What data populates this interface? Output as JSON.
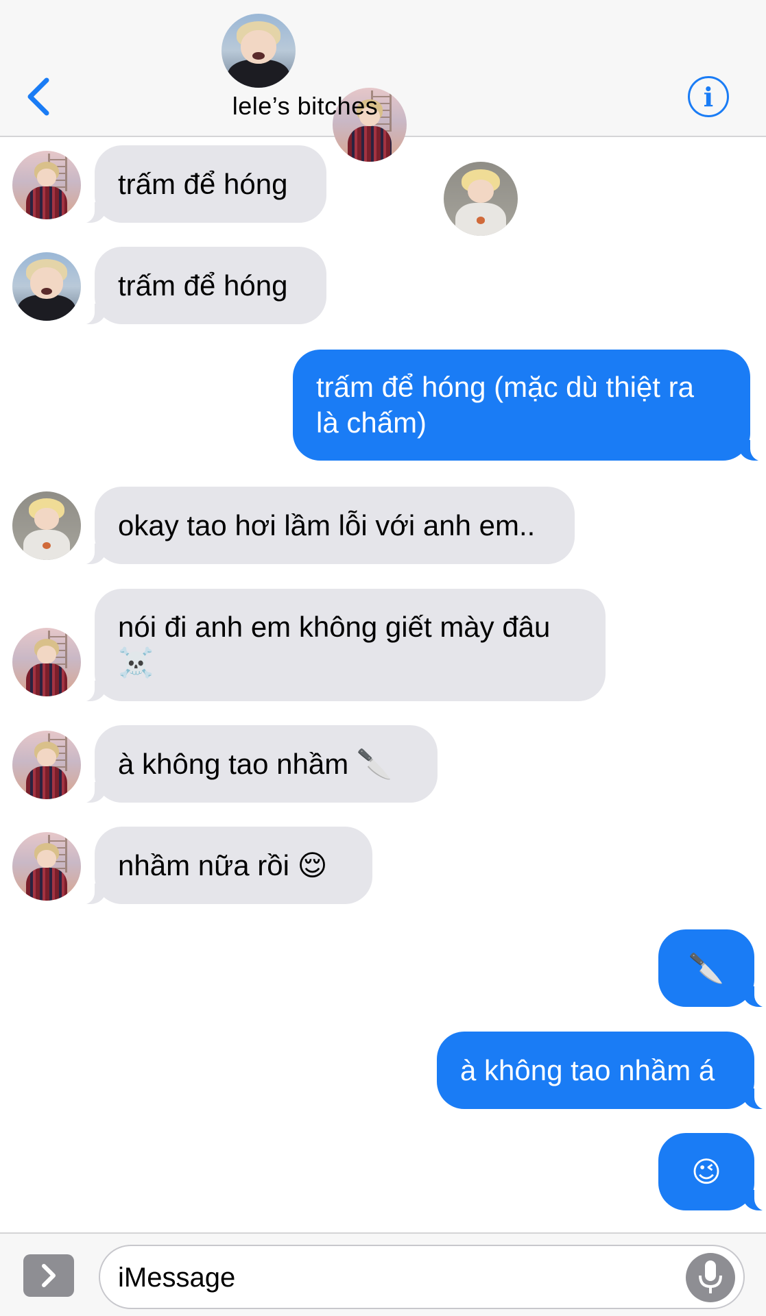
{
  "header": {
    "title": "lele’s bitches",
    "info_label": "i",
    "accent_color": "#1a7cf5"
  },
  "messages": [
    {
      "direction": "incoming",
      "sender_avatar": "avatar-plaid-shirt",
      "text": "trấm để hóng"
    },
    {
      "direction": "incoming",
      "sender_avatar": "avatar-black-hoodie",
      "text": "trấm để hóng"
    },
    {
      "direction": "outgoing",
      "lines": [
        "trấm để hóng (mặc dù thiệt ra",
        "là chấm)"
      ]
    },
    {
      "direction": "incoming",
      "sender_avatar": "avatar-blonde-white-shirt",
      "text": "okay tao hơi lầm lỗi với anh em.."
    },
    {
      "direction": "incoming",
      "sender_avatar": "avatar-plaid-shirt",
      "lines": [
        "nói đi anh em không giết mày đâu",
        "☠️"
      ]
    },
    {
      "direction": "incoming",
      "sender_avatar": "avatar-plaid-shirt",
      "text": "à không tao nhầm 🔪"
    },
    {
      "direction": "incoming",
      "sender_avatar": "avatar-plaid-shirt",
      "text": "nhầm nữa rồi 😌"
    },
    {
      "direction": "outgoing",
      "text": "🔪"
    },
    {
      "direction": "outgoing",
      "text": "à không tao nhầm á"
    },
    {
      "direction": "outgoing",
      "text": "😉"
    }
  ],
  "composer": {
    "placeholder": "iMessage"
  },
  "colors": {
    "incoming_bubble": "#e5e5ea",
    "outgoing_bubble": "#1a7cf5",
    "bar_background": "#f7f7f7"
  }
}
